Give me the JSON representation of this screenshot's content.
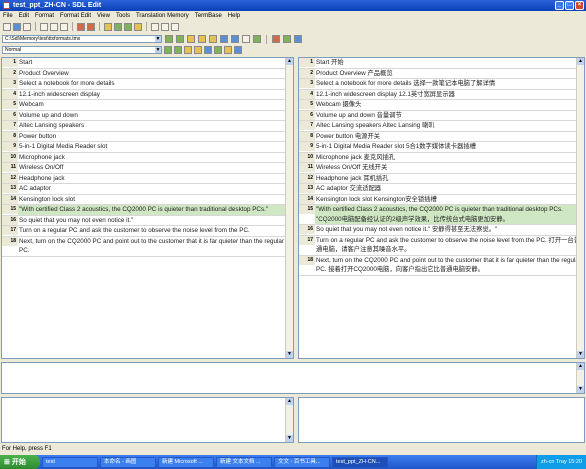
{
  "window": {
    "title": "test_ppt_ZH-CN - SDL Edit"
  },
  "menu": [
    "File",
    "Edit",
    "Format",
    "Format Edit",
    "View",
    "Tools",
    "Translation Memory",
    "TermBase",
    "Help"
  ],
  "path": {
    "file": "C:\\Sdl\\Memory\\test\\ttxformats.tmx",
    "style": "Normal"
  },
  "source_rows": [
    {
      "n": "1",
      "t": "Start"
    },
    {
      "n": "2",
      "t": "Product Overview"
    },
    {
      "n": "3",
      "t": "Select a notebook for more details"
    },
    {
      "n": "4",
      "t": "12.1-inch widescreen display"
    },
    {
      "n": "5",
      "t": "Webcam"
    },
    {
      "n": "6",
      "t": "Volume up and down"
    },
    {
      "n": "7",
      "t": "Altec Lansing speakers"
    },
    {
      "n": "8",
      "t": "Power button"
    },
    {
      "n": "9",
      "t": "5-in-1 Digital Media Reader slot"
    },
    {
      "n": "10",
      "t": "Microphone jack"
    },
    {
      "n": "11",
      "t": "Wireless On/Off"
    },
    {
      "n": "12",
      "t": "Headphone jack"
    },
    {
      "n": "13",
      "t": "AC adaptor"
    },
    {
      "n": "14",
      "t": "Kensington lock slot"
    },
    {
      "n": "15",
      "t": "\"With certified Class 2 acoustics, the CQ2000 PC is quieter than traditional desktop PCs.\"",
      "hl": true
    },
    {
      "n": "16",
      "t": "So quiet that you may not even notice it.\""
    },
    {
      "n": "17",
      "t": "Turn on a regular PC and ask the customer to observe the noise level from the PC."
    },
    {
      "n": "18",
      "t": "Next, turn on the CQ2000 PC and point out to the customer that it is far quieter than the regular PC."
    }
  ],
  "target_rows": [
    {
      "n": "1",
      "t": "Start 开始"
    },
    {
      "n": "2",
      "t": "Product Overview 产品概览"
    },
    {
      "n": "3",
      "t": "Select a notebook for more details 选择一款笔记本电脑了解详情"
    },
    {
      "n": "4",
      "t": "12.1-inch widescreen display 12.1英寸宽屏显示器"
    },
    {
      "n": "5",
      "t": "Webcam 摄像头"
    },
    {
      "n": "6",
      "t": "Volume up and down 音量调节"
    },
    {
      "n": "7",
      "t": "Altec Lansing speakers Altec Lansing 喇叭"
    },
    {
      "n": "8",
      "t": "Power button 电源开关"
    },
    {
      "n": "9",
      "t": "5-in-1 Digital Media Reader slot 5合1数字媒体读卡器插槽"
    },
    {
      "n": "10",
      "t": "Microphone jack 麦克风插孔"
    },
    {
      "n": "11",
      "t": "Wireless On/Off 无线开关"
    },
    {
      "n": "12",
      "t": "Headphone jack 耳机插孔"
    },
    {
      "n": "13",
      "t": "AC adaptor 交流适配器"
    },
    {
      "n": "14",
      "t": "Kensington lock slot Kensington安全锁插槽"
    },
    {
      "n": "15",
      "t": "\"With certified Class 2 acoustics, the CQ2000 PC is quieter than traditional desktop PCs. \"CQ2000电脑配备经认证的2级声学效果，比传统台式电脑更加安静。",
      "hl": true
    },
    {
      "n": "16",
      "t": "So quiet that you may not even notice it.\" 安静得甚至无法察觉。\""
    },
    {
      "n": "17",
      "t": "Turn on a regular PC and ask the customer to observe the noise level from the PC. 打开一台普通电脑，请客户注意其噪音水平。"
    },
    {
      "n": "18",
      "t": "Next, turn on the CQ2000 PC and point out to the customer that it is far quieter than the regular PC. 接着打开CQ2000电脑，向客户指出它比普通电脑安静。"
    }
  ],
  "status": {
    "help": "For Help, press F1"
  },
  "taskbar": {
    "start": "开始",
    "items": [
      "test",
      "本命名 - 画图",
      "新建 Microsoft ...",
      "新建 文本文档 ...",
      "文文 - 百书工具...",
      "test_ppt_ZH-CN..."
    ],
    "tray": "zh-cn  Tray  15:20"
  }
}
